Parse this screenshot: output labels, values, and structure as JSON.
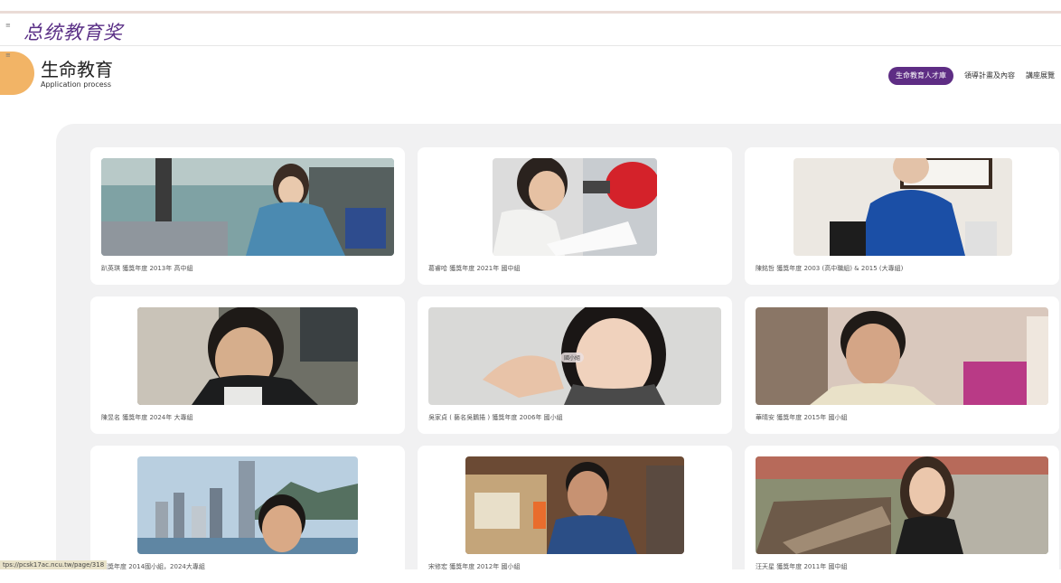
{
  "header": {
    "logo_text": "总统教育奖",
    "page_title": "生命教育",
    "page_subtitle": "Application process"
  },
  "nav": {
    "tabs": [
      "生命教育人才庫",
      "領導計畫及內容",
      "講座展覽"
    ]
  },
  "cards": [
    {
      "caption": "趴英琪 獲獎年度 2013年 高中組"
    },
    {
      "caption": "葛睿哈 獲獎年度 2021年 國中組"
    },
    {
      "caption": "陳銘哲 獲獎年度 2003 (高中職組) & 2015 (大專組)"
    },
    {
      "caption": "陳昱名 獲獎年度 2024年 大專組"
    },
    {
      "caption": "吳家貞 ( 藝名吳鵝捲 ) 獲獎年度 2006年 國小組",
      "badge": "國小組"
    },
    {
      "caption": "華晴安 獲獎年度 2015年 國小組"
    },
    {
      "caption": "獲獎年度 2014國小組，2024大專組"
    },
    {
      "caption": "宋修宏 獲獎年度 2012年 國小組"
    },
    {
      "caption": "汪天星 獲獎年度 2011年 國中組"
    }
  ],
  "status_bar": {
    "url": "tps://pcsk17ac.ncu.tw/page/318"
  },
  "colors": {
    "accent": "#5e2d84",
    "side_tab": "#f2b466",
    "panel": "#f1f1f2"
  }
}
